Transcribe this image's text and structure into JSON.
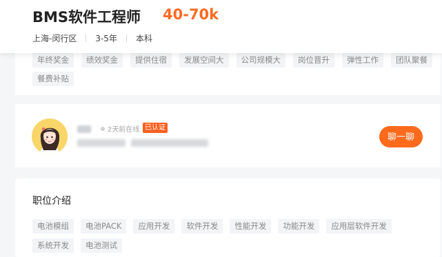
{
  "job": {
    "title": "BMS软件工程师",
    "salary": "40-70k",
    "location": "上海-闵行区",
    "experience": "3-5年",
    "degree": "本科"
  },
  "welfare_tags": [
    "年终奖金",
    "绩效奖金",
    "提供住宿",
    "发展空间大",
    "公司规模大",
    "岗位晋升",
    "弹性工作",
    "团队聚餐",
    "餐费补贴"
  ],
  "recruiter": {
    "online_status": "2天前在线",
    "verified_badge": "已认证",
    "chat_button": "聊一聊"
  },
  "description": {
    "section_title": "职位介绍",
    "skill_tags": [
      "电池模组",
      "电池PACK",
      "应用开发",
      "软件开发",
      "性能开发",
      "功能开发",
      "应用层软件开发",
      "系统开发",
      "电池测试"
    ]
  },
  "colors": {
    "accent": "#fe6b24",
    "chat_button": "#fe6a1c",
    "verified": "#fe5f1e",
    "tag_bg": "#f3f4f6"
  }
}
